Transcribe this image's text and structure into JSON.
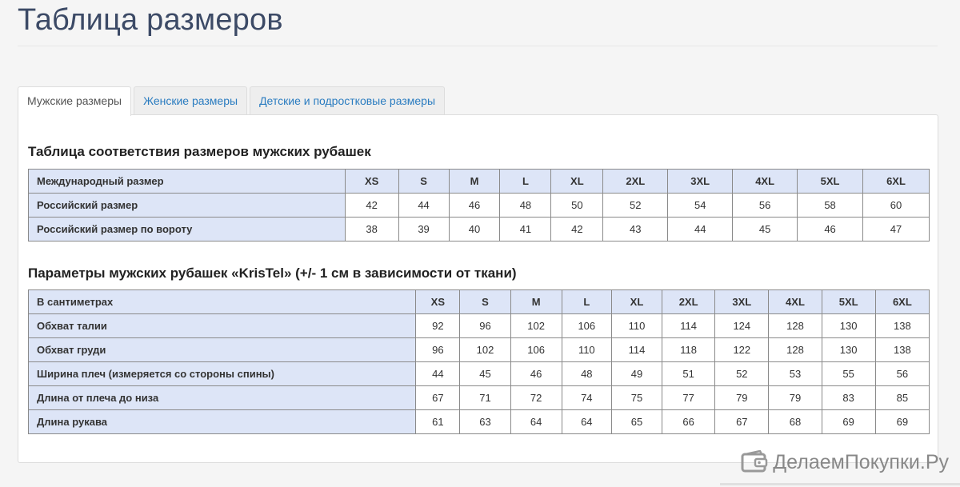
{
  "page": {
    "title": "Таблица размеров"
  },
  "tabs": [
    {
      "label": "Мужские размеры",
      "active": true
    },
    {
      "label": "Женские размеры",
      "active": false
    },
    {
      "label": "Детские и подростковые размеры",
      "active": false
    }
  ],
  "section1": {
    "heading": "Таблица соответствия размеров мужских рубашек",
    "rows": [
      {
        "label": "Международный размер",
        "values": [
          "XS",
          "S",
          "M",
          "L",
          "XL",
          "2XL",
          "3XL",
          "4XL",
          "5XL",
          "6XL"
        ]
      },
      {
        "label": "Российский размер",
        "values": [
          "42",
          "44",
          "46",
          "48",
          "50",
          "52",
          "54",
          "56",
          "58",
          "60"
        ]
      },
      {
        "label": "Российский размер по вороту",
        "values": [
          "38",
          "39",
          "40",
          "41",
          "42",
          "43",
          "44",
          "45",
          "46",
          "47"
        ]
      }
    ]
  },
  "section2": {
    "heading": "Параметры мужских рубашек «KrisTel» (+/- 1 см в зависимости от ткани)",
    "rows": [
      {
        "label": "В сантиметрах",
        "values": [
          "XS",
          "S",
          "M",
          "L",
          "XL",
          "2XL",
          "3XL",
          "4XL",
          "5XL",
          "6XL"
        ]
      },
      {
        "label": "Обхват талии",
        "values": [
          "92",
          "96",
          "102",
          "106",
          "110",
          "114",
          "124",
          "128",
          "130",
          "138"
        ]
      },
      {
        "label": "Обхват груди",
        "values": [
          "96",
          "102",
          "106",
          "110",
          "114",
          "118",
          "122",
          "128",
          "130",
          "138"
        ]
      },
      {
        "label": "Ширина плеч (измеряется со стороны спины)",
        "values": [
          "44",
          "45",
          "46",
          "48",
          "49",
          "51",
          "52",
          "53",
          "55",
          "56"
        ]
      },
      {
        "label": "Длина от плеча до низа",
        "values": [
          "67",
          "71",
          "72",
          "74",
          "75",
          "77",
          "79",
          "79",
          "83",
          "85"
        ]
      },
      {
        "label": "Длина рукава",
        "values": [
          "61",
          "63",
          "64",
          "64",
          "65",
          "66",
          "67",
          "68",
          "69",
          "69"
        ]
      }
    ]
  },
  "watermark": {
    "text": "ДелаемПокупки.Ру",
    "icon": "wallet-icon"
  },
  "colors": {
    "title": "#3c4a66",
    "tab_link": "#2a7cc0",
    "table_header_bg": "#dde5f7",
    "table_border": "#8a8a8a"
  }
}
